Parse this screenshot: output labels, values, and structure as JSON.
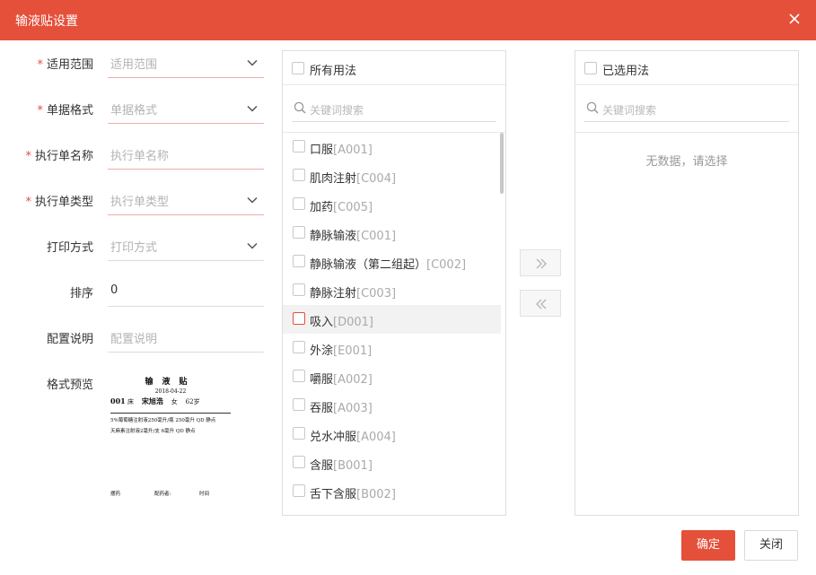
{
  "dialog": {
    "title": "输液贴设置"
  },
  "form": {
    "rows": [
      {
        "label": "适用范围",
        "required": true,
        "value": "适用范围",
        "placeholder": true,
        "dropdown": true
      },
      {
        "label": "单据格式",
        "required": true,
        "value": "单据格式",
        "placeholder": true,
        "dropdown": true
      },
      {
        "label": "执行单名称",
        "required": true,
        "value": "执行单名称",
        "placeholder": true,
        "dropdown": false
      },
      {
        "label": "执行单类型",
        "required": true,
        "value": "执行单类型",
        "placeholder": true,
        "dropdown": true
      },
      {
        "label": "打印方式",
        "required": false,
        "value": "打印方式",
        "placeholder": true,
        "dropdown": true
      },
      {
        "label": "排序",
        "required": false,
        "value": "0",
        "placeholder": false,
        "dropdown": false
      },
      {
        "label": "配置说明",
        "required": false,
        "value": "配置说明",
        "placeholder": true,
        "dropdown": false
      }
    ],
    "preview_label": "格式预览",
    "required_mark": "*"
  },
  "preview": {
    "title": "输液贴",
    "date": "2018-04-22",
    "bed": "001",
    "bed_suffix": "床",
    "patient": "宋旭浩",
    "sex": "女",
    "age": "62岁",
    "line1": "5%葡萄糖注射液250毫升/瓶  250毫升  QD   静点",
    "line2": "天麻素注射液2毫升/支     6毫升   QD   静点",
    "footer": [
      "摆药",
      "配药者:",
      "时间"
    ]
  },
  "left_panel": {
    "header": "所有用法",
    "search_placeholder": "关键词搜索",
    "items": [
      {
        "name": "口服",
        "code": "[A001]"
      },
      {
        "name": "肌肉注射",
        "code": "[C004]"
      },
      {
        "name": "加药",
        "code": "[C005]"
      },
      {
        "name": "静脉输液",
        "code": "[C001]"
      },
      {
        "name": "静脉输液（第二组起）",
        "code": "[C002]"
      },
      {
        "name": "静脉注射",
        "code": "[C003]"
      },
      {
        "name": "吸入",
        "code": "[D001]"
      },
      {
        "name": "外涂",
        "code": "[E001]"
      },
      {
        "name": "嚼服",
        "code": "[A002]"
      },
      {
        "name": "吞服",
        "code": "[A003]"
      },
      {
        "name": "兑水冲服",
        "code": "[A004]"
      },
      {
        "name": "含服",
        "code": "[B001]"
      },
      {
        "name": "舌下含服",
        "code": "[B002]"
      }
    ]
  },
  "right_panel": {
    "header": "已选用法",
    "search_placeholder": "关键词搜索",
    "empty_text": "无数据，请选择"
  },
  "buttons": {
    "confirm": "确定",
    "close": "关闭"
  },
  "colors": {
    "accent": "#e5503a"
  }
}
